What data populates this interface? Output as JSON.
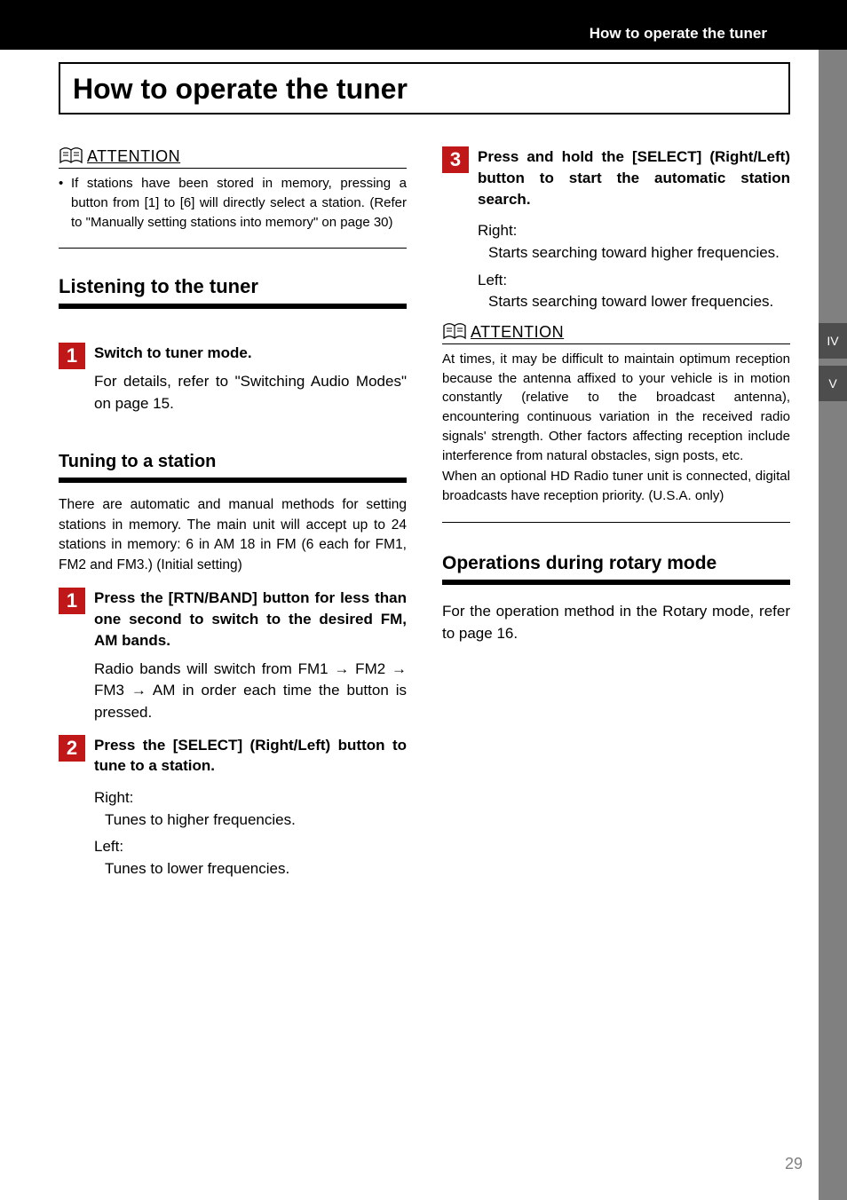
{
  "header": {
    "running_title": "How to operate the tuner"
  },
  "tabs": {
    "iv": "IV",
    "v": "V"
  },
  "title": "How to operate the tuner",
  "attention_label": "ATTENTION",
  "left": {
    "attn1": "If stations have been stored in memory, pressing a button from [1] to [6] will directly select a station. (Refer to \"Manually setting stations into memory\" on page 30)",
    "sec_listen": "Listening to the tuner",
    "step1_num": "1",
    "step1_head": "Switch to tuner mode.",
    "step1_text": "For details, refer to \"Switching Audio Modes\" on page 15.",
    "sec_tuning": "Tuning to a station",
    "tuning_intro": "There are automatic and manual methods for setting stations in memory. The main unit will accept up to 24 stations in memory: 6 in AM 18 in FM (6 each for FM1, FM2 and FM3.) (Initial setting)",
    "t_step1_num": "1",
    "t_step1_head": "Press the [RTN/BAND] button for less than one second to switch to the desired FM, AM bands.",
    "t_step1_text": "Radio bands will switch from FM1 → FM2 → FM3 → AM in order each time the button is pressed.",
    "t_step2_num": "2",
    "t_step2_head": "Press the [SELECT] (Right/Left) button to tune to a station.",
    "t_step2_right_lbl": "Right:",
    "t_step2_right_desc": "Tunes to higher frequencies.",
    "t_step2_left_lbl": "Left:",
    "t_step2_left_desc": "Tunes to lower frequencies."
  },
  "right": {
    "t_step3_num": "3",
    "t_step3_head": "Press and hold the [SELECT] (Right/Left) button to start the automatic station search.",
    "t_step3_right_lbl": "Right:",
    "t_step3_right_desc": "Starts searching toward higher frequencies.",
    "t_step3_left_lbl": "Left:",
    "t_step3_left_desc": "Starts searching toward lower frequencies.",
    "attn2a": "At times, it may be difficult to maintain optimum reception because the antenna affixed to your vehicle is in motion constantly (relative to the broadcast antenna), encountering continuous variation in the received radio signals' strength. Other factors affecting reception include interference from natural obstacles, sign posts, etc.",
    "attn2b": "When an optional HD Radio tuner unit is connected, digital broadcasts have reception priority. (U.S.A. only)",
    "sec_rotary": "Operations during rotary mode",
    "rotary_text": "For the operation method in the Rotary mode, refer to page 16."
  },
  "page_number": "29"
}
